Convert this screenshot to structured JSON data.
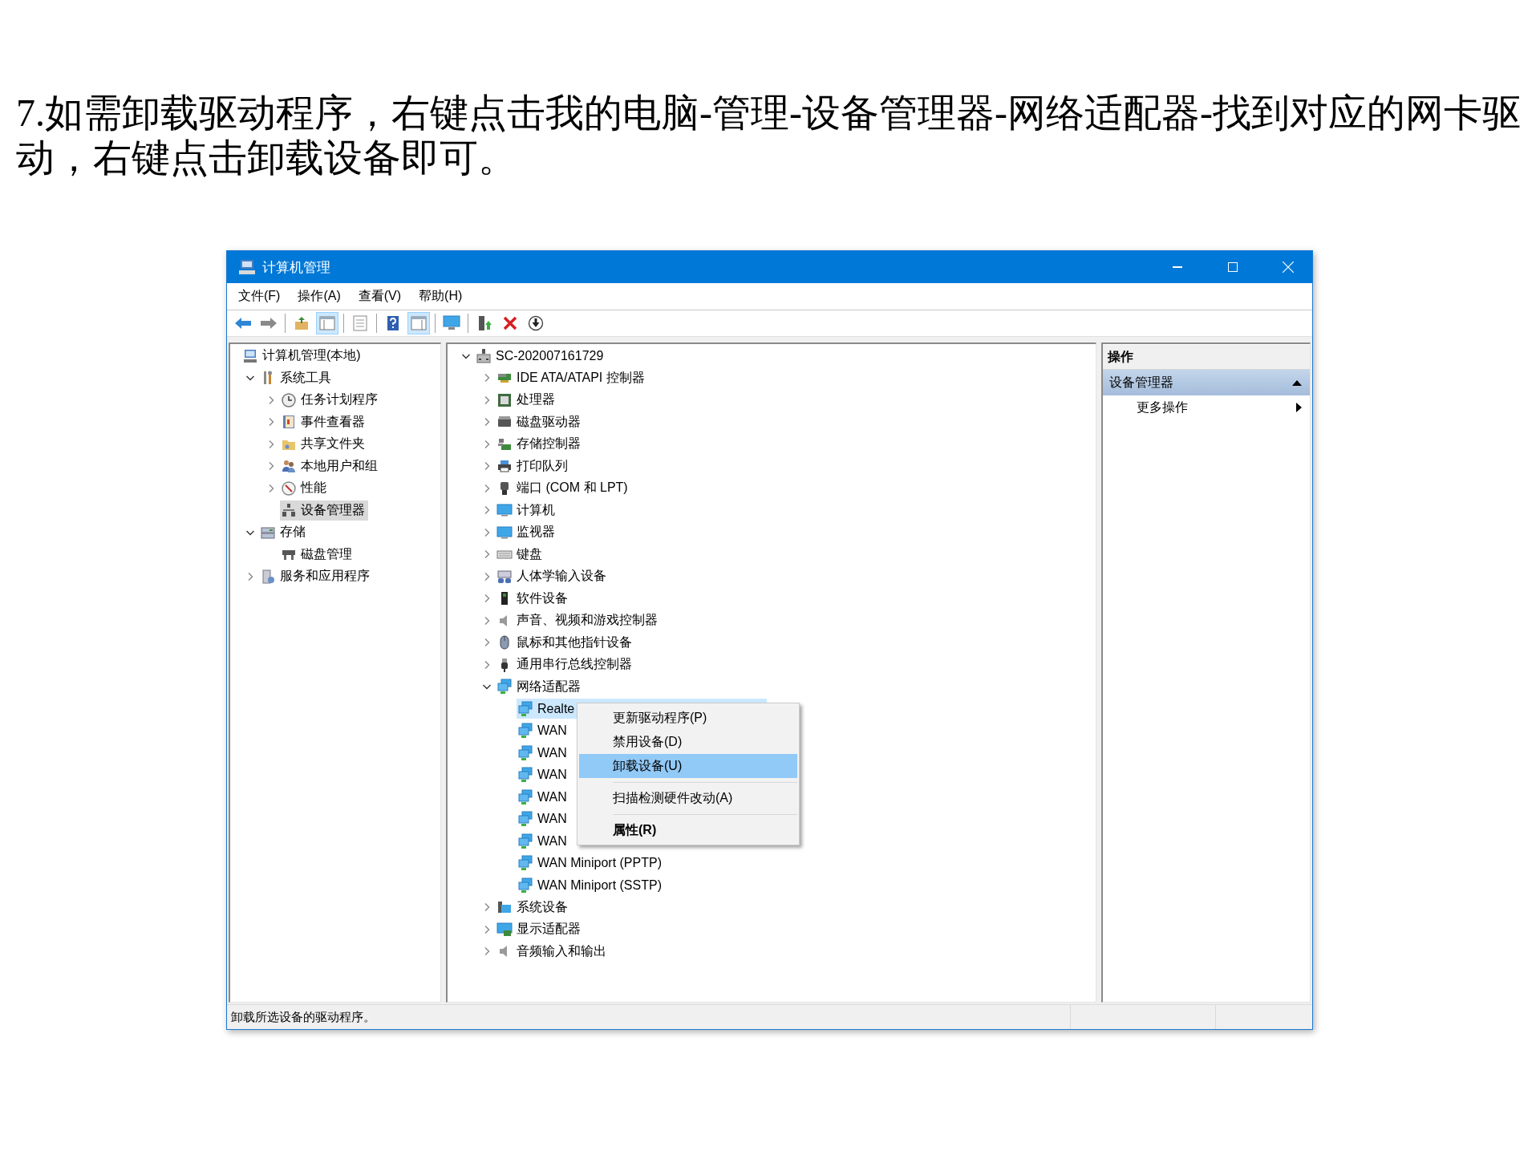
{
  "instruction": "7.如需卸载驱动程序，右键点击我的电脑-管理-设备管理器-网络适配器-找到对应的网卡驱动，右键点击卸载设备即可。",
  "window": {
    "title": "计算机管理"
  },
  "menu_bar": [
    "文件(F)",
    "操作(A)",
    "查看(V)",
    "帮助(H)"
  ],
  "toolbar": [
    {
      "pressed": false
    },
    {
      "pressed": false
    },
    {
      "pressed": false
    },
    {
      "pressed": true
    },
    {
      "pressed": false
    },
    {
      "pressed": false
    },
    {
      "pressed": true
    },
    {
      "pressed": false
    },
    {
      "pressed": false
    },
    {
      "pressed": false
    },
    {
      "pressed": false
    }
  ],
  "console_tree": [
    {
      "label": "计算机管理(本地)",
      "selected": false,
      "children": [
        {
          "label": "系统工具",
          "expanded": true,
          "selected": false,
          "children": [
            {
              "label": "任务计划程序",
              "expanded": false,
              "selected": false
            },
            {
              "label": "事件查看器",
              "expanded": false,
              "selected": false
            },
            {
              "label": "共享文件夹",
              "expanded": false,
              "selected": false
            },
            {
              "label": "本地用户和组",
              "expanded": false,
              "selected": false
            },
            {
              "label": "性能",
              "expanded": false,
              "selected": false
            },
            {
              "label": "设备管理器",
              "selected": true
            }
          ]
        },
        {
          "label": "存储",
          "expanded": true,
          "selected": false,
          "children": [
            {
              "label": "磁盘管理",
              "selected": false
            }
          ]
        },
        {
          "label": "服务和应用程序",
          "expanded": false,
          "selected": false
        }
      ]
    }
  ],
  "device_tree": [
    {
      "label": "SC-202007161729",
      "expanded": true,
      "selected": false,
      "children": [
        {
          "label": "IDE ATA/ATAPI 控制器",
          "expanded": false,
          "selected": false
        },
        {
          "label": "处理器",
          "expanded": false,
          "selected": false
        },
        {
          "label": "磁盘驱动器",
          "expanded": false,
          "selected": false
        },
        {
          "label": "存储控制器",
          "expanded": false,
          "selected": false
        },
        {
          "label": "打印队列",
          "expanded": false,
          "selected": false
        },
        {
          "label": "端口 (COM 和 LPT)",
          "expanded": false,
          "selected": false
        },
        {
          "label": "计算机",
          "expanded": false,
          "selected": false
        },
        {
          "label": "监视器",
          "expanded": false,
          "selected": false
        },
        {
          "label": "键盘",
          "expanded": false,
          "selected": false
        },
        {
          "label": "人体学输入设备",
          "expanded": false,
          "selected": false
        },
        {
          "label": "软件设备",
          "expanded": false,
          "selected": false
        },
        {
          "label": "声音、视频和游戏控制器",
          "expanded": false,
          "selected": false
        },
        {
          "label": "鼠标和其他指针设备",
          "expanded": false,
          "selected": false
        },
        {
          "label": "通用串行总线控制器",
          "expanded": false,
          "selected": false
        },
        {
          "label": "网络适配器",
          "expanded": true,
          "selected": false,
          "children": [
            {
              "label": "Realte",
              "selected": true
            },
            {
              "label": "WAN",
              "selected": false
            },
            {
              "label": "WAN",
              "selected": false
            },
            {
              "label": "WAN",
              "selected": false
            },
            {
              "label": "WAN",
              "selected": false
            },
            {
              "label": "WAN",
              "selected": false
            },
            {
              "label": "WAN",
              "selected": false
            },
            {
              "label": "WAN Miniport (PPTP)",
              "selected": false
            },
            {
              "label": "WAN Miniport (SSTP)",
              "selected": false
            }
          ]
        },
        {
          "label": "系统设备",
          "expanded": false,
          "selected": false
        },
        {
          "label": "显示适配器",
          "expanded": false,
          "selected": false
        },
        {
          "label": "音频输入和输出",
          "expanded": false,
          "selected": false
        }
      ]
    }
  ],
  "context_menu": [
    {
      "kind": "item",
      "label": "更新驱动程序(P)",
      "selected": false,
      "default": false
    },
    {
      "kind": "item",
      "label": "禁用设备(D)",
      "selected": false,
      "default": false
    },
    {
      "kind": "item",
      "label": "卸载设备(U)",
      "selected": true,
      "default": false
    },
    {
      "kind": "separator"
    },
    {
      "kind": "item",
      "label": "扫描检测硬件改动(A)",
      "selected": false,
      "default": false
    },
    {
      "kind": "separator"
    },
    {
      "kind": "item",
      "label": "属性(R)",
      "selected": false,
      "default": true
    }
  ],
  "actions_pane": {
    "title": "操作",
    "section": {
      "label": "设备管理器",
      "expanded": true
    },
    "items": [
      "更多操作"
    ]
  },
  "status_bar": {
    "text": "卸载所选设备的驱动程序。"
  }
}
